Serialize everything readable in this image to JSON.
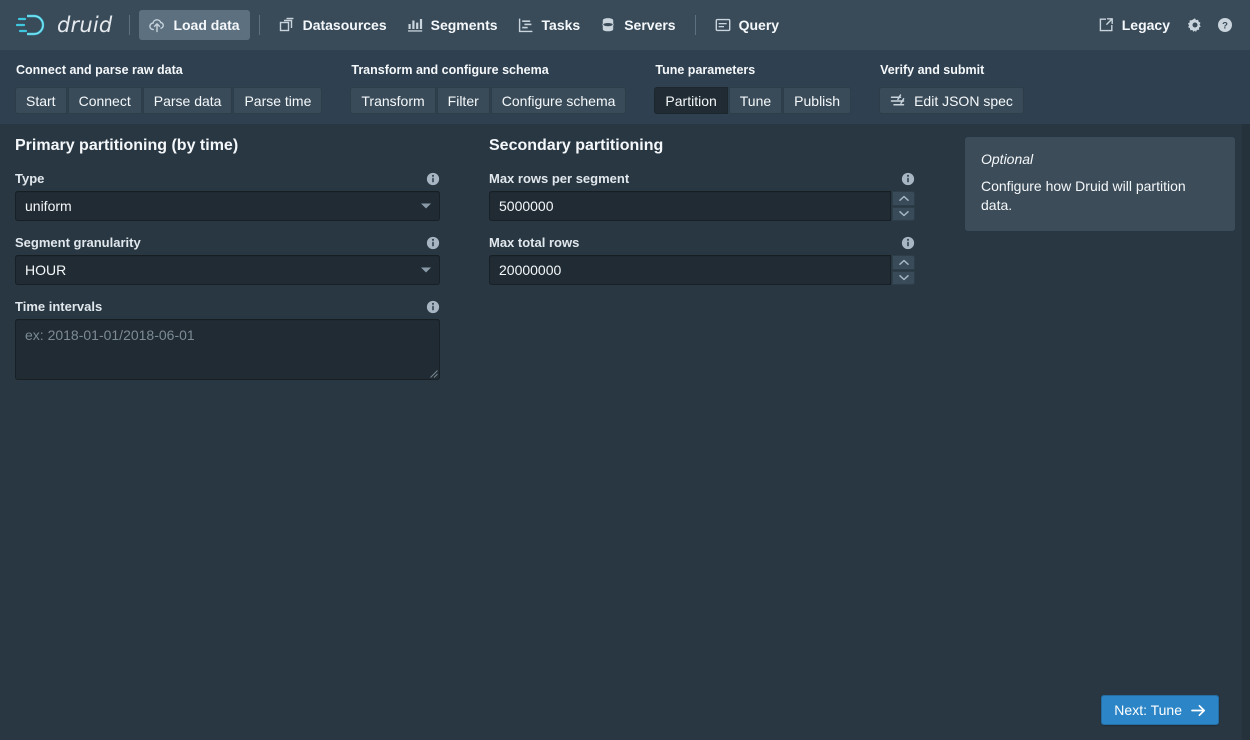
{
  "navbar": {
    "logo_text": "druid",
    "items": [
      {
        "label": "Load data",
        "icon": "cloud-upload-icon",
        "active": true
      },
      {
        "label": "Datasources",
        "icon": "multi-select-icon",
        "active": false
      },
      {
        "label": "Segments",
        "icon": "bar-chart-icon",
        "active": false
      },
      {
        "label": "Tasks",
        "icon": "gantt-chart-icon",
        "active": false
      },
      {
        "label": "Servers",
        "icon": "database-icon",
        "active": false
      },
      {
        "label": "Query",
        "icon": "application-icon",
        "active": false
      }
    ],
    "legacy_label": "Legacy",
    "legacy_icon": "share-external-icon",
    "settings_icon": "gear-icon",
    "help_icon": "help-icon"
  },
  "steps": [
    {
      "title": "Connect and parse raw data",
      "buttons": [
        {
          "label": "Start",
          "active": false
        },
        {
          "label": "Connect",
          "active": false
        },
        {
          "label": "Parse data",
          "active": false
        },
        {
          "label": "Parse time",
          "active": false
        }
      ]
    },
    {
      "title": "Transform and configure schema",
      "buttons": [
        {
          "label": "Transform",
          "active": false
        },
        {
          "label": "Filter",
          "active": false
        },
        {
          "label": "Configure schema",
          "active": false
        }
      ]
    },
    {
      "title": "Tune parameters",
      "buttons": [
        {
          "label": "Partition",
          "active": true
        },
        {
          "label": "Tune",
          "active": false
        },
        {
          "label": "Publish",
          "active": false
        }
      ]
    }
  ],
  "verify": {
    "title": "Verify and submit",
    "edit_json_label": "Edit JSON spec",
    "edit_json_icon": "style-icon"
  },
  "primary": {
    "title": "Primary partitioning (by time)",
    "type": {
      "label": "Type",
      "value": "uniform",
      "info_icon": "info-sign-icon"
    },
    "granularity": {
      "label": "Segment granularity",
      "value": "HOUR",
      "info_icon": "info-sign-icon"
    },
    "intervals": {
      "label": "Time intervals",
      "value": "",
      "placeholder": "ex: 2018-01-01/2018-06-01",
      "info_icon": "info-sign-icon"
    }
  },
  "secondary": {
    "title": "Secondary partitioning",
    "max_rows_per_segment": {
      "label": "Max rows per segment",
      "value": "5000000",
      "info_icon": "info-sign-icon"
    },
    "max_total_rows": {
      "label": "Max total rows",
      "value": "20000000",
      "info_icon": "info-sign-icon"
    }
  },
  "callout": {
    "heading": "Optional",
    "body": "Configure how Druid will partition data."
  },
  "footer": {
    "next_label": "Next: Tune",
    "next_icon": "arrow-right-icon"
  },
  "colors": {
    "navbar_bg": "#394b59",
    "stepbar_bg": "#2f4050",
    "content_bg": "#293742",
    "input_bg": "#202b33",
    "active_step_bg": "#202b33",
    "accent_blue": "#2b85c7",
    "logo_cyan": "#3fc7e0",
    "callout_bg": "#3c4c59"
  }
}
